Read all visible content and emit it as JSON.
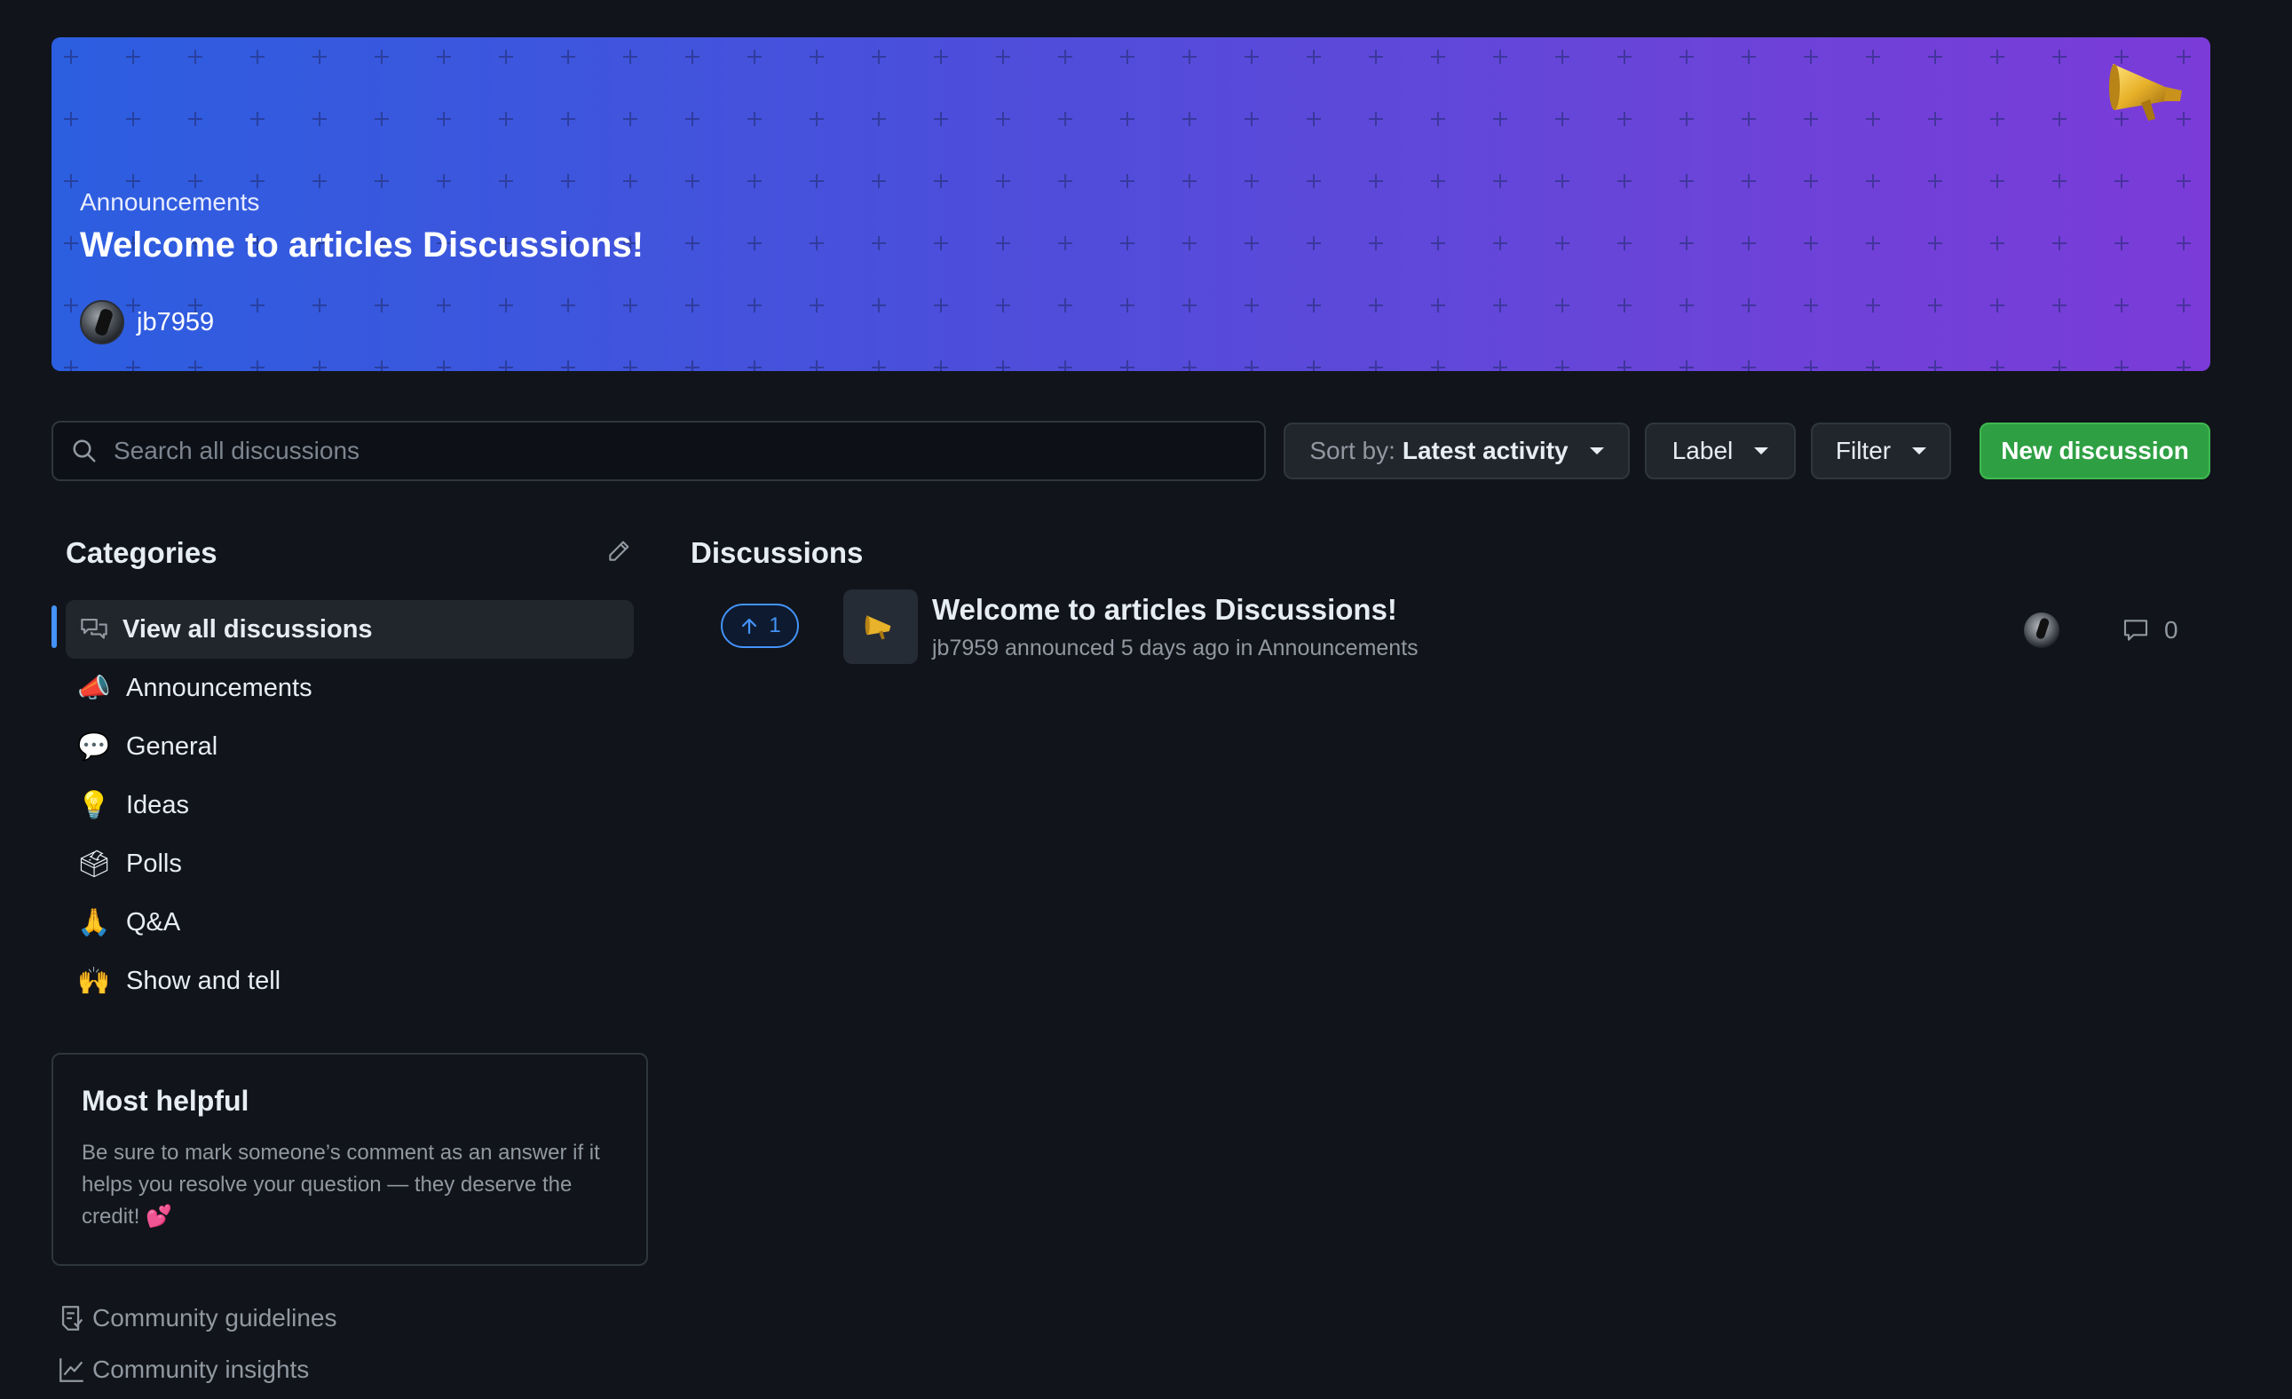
{
  "banner": {
    "category": "Announcements",
    "title": "Welcome to articles Discussions!",
    "author": "jb7959",
    "megaphone_icon": "megaphone-icon"
  },
  "toolbar": {
    "search_placeholder": "Search all discussions",
    "sort_prefix": "Sort by:",
    "sort_value": "Latest activity",
    "label_button": "Label",
    "filter_button": "Filter",
    "new_discussion_button": "New discussion",
    "new_discussion_color": "#2ea043"
  },
  "sidebar": {
    "heading": "Categories",
    "items": [
      {
        "label": "View all discussions",
        "icon": "comment-discussion-icon",
        "active": true
      },
      {
        "label": "Announcements",
        "icon": "megaphone-icon",
        "emoji": "📣"
      },
      {
        "label": "General",
        "icon": "speech-balloon-icon",
        "emoji": "💬"
      },
      {
        "label": "Ideas",
        "icon": "lightbulb-icon",
        "emoji": "💡"
      },
      {
        "label": "Polls",
        "icon": "ballot-box-icon",
        "emoji": "🗳"
      },
      {
        "label": "Q&A",
        "icon": "pray-icon",
        "emoji": "🙏"
      },
      {
        "label": "Show and tell",
        "icon": "raised-hands-icon",
        "emoji": "🙌"
      }
    ],
    "most_helpful": {
      "title": "Most helpful",
      "text": "Be sure to mark someone’s comment as an answer if it helps you resolve your question — they deserve the credit! 💕"
    },
    "links": [
      {
        "label": "Community guidelines",
        "icon": "book-icon"
      },
      {
        "label": "Community insights",
        "icon": "graph-icon"
      }
    ]
  },
  "discussions": {
    "heading": "Discussions",
    "items": [
      {
        "votes": "1",
        "title": "Welcome to articles Discussions!",
        "meta": "jb7959 announced 5 days ago in Announcements",
        "comments": "0"
      }
    ]
  },
  "colors": {
    "background": "#11141a",
    "accent": "#4493f8",
    "banner_start": "#2c5ee0",
    "banner_end": "#7b3bd9"
  }
}
